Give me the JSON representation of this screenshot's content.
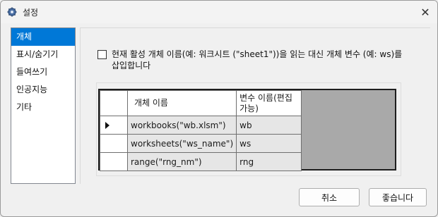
{
  "window": {
    "title": "설정",
    "close_glyph": "✕",
    "icon": "gear-icon"
  },
  "nav": {
    "items": [
      {
        "label": "개체",
        "selected": true
      },
      {
        "label": "표시/숨기기",
        "selected": false
      },
      {
        "label": "들여쓰기",
        "selected": false
      },
      {
        "label": "인공지능",
        "selected": false
      },
      {
        "label": "기타",
        "selected": false
      }
    ]
  },
  "option": {
    "text": "현재 활성 개체 이름(예: 워크시트 (\"sheet1\"))을 읽는 대신 개체 변수 (예: ws)를 삽입합니다",
    "checked": false
  },
  "grid": {
    "headers": [
      "개체 이름",
      "변수 이름(편집가능)"
    ],
    "rows": [
      {
        "object": "workbooks(\"wb.xlsm\")",
        "variable": "wb",
        "current": true
      },
      {
        "object": "worksheets(\"ws_name\")",
        "variable": "ws",
        "current": false
      },
      {
        "object": "range(\"rng_nm\")",
        "variable": "rng",
        "current": false
      }
    ]
  },
  "buttons": {
    "cancel": "취소",
    "ok": "좋습니다"
  },
  "colors": {
    "selection": "#0078d7",
    "grid_background": "#a9a9a9",
    "cell_background": "#e6e6e6"
  }
}
